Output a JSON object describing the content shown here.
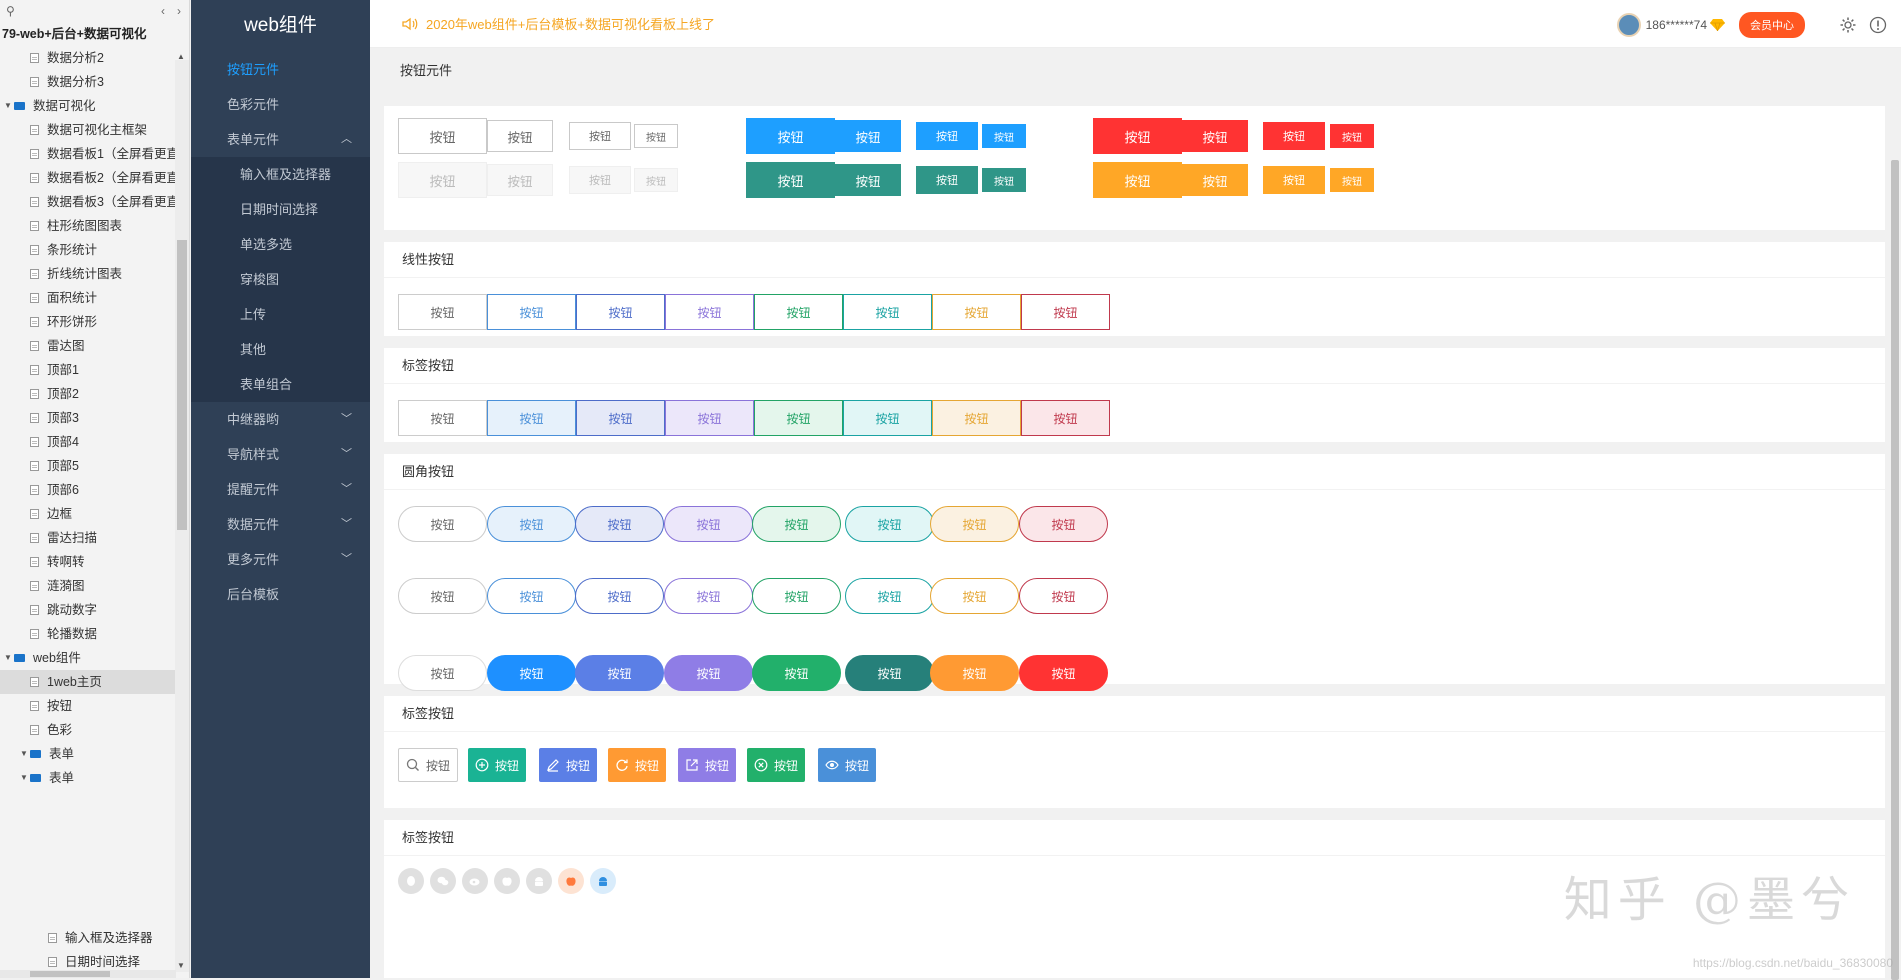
{
  "tree": {
    "root": "79-web+后台+数据可视化",
    "nodes": [
      {
        "label": "数据分析2",
        "type": "page",
        "indent": 1
      },
      {
        "label": "数据分析3",
        "type": "page",
        "indent": 1
      },
      {
        "label": "数据可视化",
        "type": "folder",
        "indent": 0
      },
      {
        "label": "数据可视化主框架",
        "type": "page",
        "indent": 1
      },
      {
        "label": "数据看板1（全屏看更直",
        "type": "page",
        "indent": 1
      },
      {
        "label": "数据看板2（全屏看更直",
        "type": "page",
        "indent": 1
      },
      {
        "label": "数据看板3（全屏看更直",
        "type": "page",
        "indent": 1
      },
      {
        "label": "柱形统图图表",
        "type": "page",
        "indent": 1
      },
      {
        "label": "条形统计",
        "type": "page",
        "indent": 1
      },
      {
        "label": "折线统计图表",
        "type": "page",
        "indent": 1
      },
      {
        "label": "面积统计",
        "type": "page",
        "indent": 1
      },
      {
        "label": "环形饼形",
        "type": "page",
        "indent": 1
      },
      {
        "label": "雷达图",
        "type": "page",
        "indent": 1
      },
      {
        "label": "顶部1",
        "type": "page",
        "indent": 1
      },
      {
        "label": "顶部2",
        "type": "page",
        "indent": 1
      },
      {
        "label": "顶部3",
        "type": "page",
        "indent": 1
      },
      {
        "label": "顶部4",
        "type": "page",
        "indent": 1
      },
      {
        "label": "顶部5",
        "type": "page",
        "indent": 1
      },
      {
        "label": "顶部6",
        "type": "page",
        "indent": 1
      },
      {
        "label": "边框",
        "type": "page",
        "indent": 1
      },
      {
        "label": "雷达扫描",
        "type": "page",
        "indent": 1
      },
      {
        "label": "转啊转",
        "type": "page",
        "indent": 1
      },
      {
        "label": "涟漪图",
        "type": "page",
        "indent": 1
      },
      {
        "label": "跳动数字",
        "type": "page",
        "indent": 1
      },
      {
        "label": "轮播数据",
        "type": "page",
        "indent": 1
      },
      {
        "label": "web组件",
        "type": "folder",
        "indent": 0
      },
      {
        "label": "1web主页",
        "type": "page",
        "indent": 1,
        "selected": true
      },
      {
        "label": "按钮",
        "type": "page",
        "indent": 1
      },
      {
        "label": "色彩",
        "type": "page",
        "indent": 1
      },
      {
        "label": "表单",
        "type": "folder",
        "indent": 1
      },
      {
        "label": "表单",
        "type": "folder",
        "indent": 1
      }
    ],
    "tail": [
      "输入框及选择器",
      "日期时间选择"
    ]
  },
  "sidebar": {
    "title": "web组件",
    "items": [
      {
        "label": "按钮元件",
        "active": true
      },
      {
        "label": "色彩元件"
      },
      {
        "label": "表单元件",
        "expanded": true
      }
    ],
    "subitems": [
      "输入框及选择器",
      "日期时间选择",
      "单选多选",
      "穿梭图",
      "上传",
      "其他",
      "表单组合"
    ],
    "items2": [
      {
        "label": "中继器哟",
        "chev": true
      },
      {
        "label": "导航样式",
        "chev": true
      },
      {
        "label": "提醒元件",
        "chev": true
      },
      {
        "label": "数据元件",
        "chev": true
      },
      {
        "label": "更多元件",
        "chev": true
      },
      {
        "label": "后台模板"
      }
    ]
  },
  "topbar": {
    "notice": "2020年web组件+后台模板+数据可视化看板上线了",
    "user": "186******74",
    "vip": "会员中心"
  },
  "page_header": "按钮元件",
  "sections": {
    "s1": "线性按钮",
    "s2": "标签按钮",
    "s3": "圆角按钮",
    "s4": "标签按钮",
    "s5": "标签按钮"
  },
  "btn": "按钮",
  "colors": {
    "blue": "#1e9fff",
    "teal": "#2f9688",
    "red": "#ff3333",
    "orange": "#ffa726",
    "gray": "#cccccc",
    "light_blue": "#4a90d9",
    "indigo": "#4d6cc9",
    "purple": "#8a73d9",
    "green": "#22a366",
    "cyan": "#1aa3a3",
    "gold": "#e5a633",
    "crimson": "#c0394d"
  },
  "watermark": "知乎 @墨兮",
  "watermark2": "https://blog.csdn.net/baidu_36830080"
}
